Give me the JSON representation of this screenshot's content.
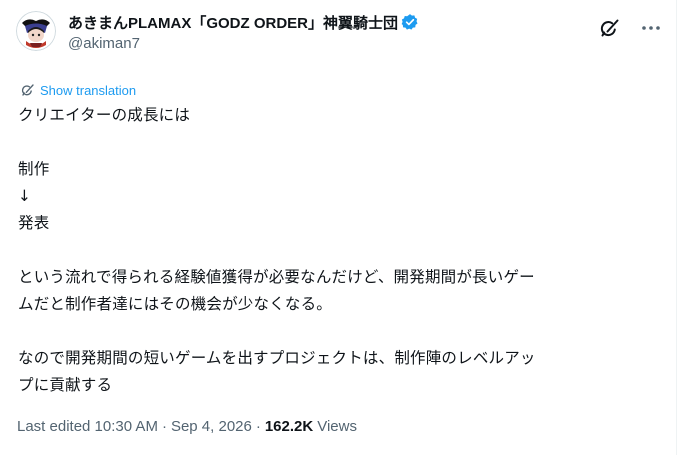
{
  "author": {
    "display_name": "あきまんPLAMAX「GODZ ORDER」神翼騎士団",
    "handle": "@akiman7",
    "avatar_icon": "avatar-illustration",
    "verified_icon": "verified-badge-icon",
    "verified_color": "#1d9bf0"
  },
  "actions": {
    "grok_icon": "grok-icon",
    "more_icon": "more-options-icon"
  },
  "translation": {
    "label": "Show translation",
    "icon": "translate-icon",
    "color": "#1d9bf0"
  },
  "tweet": {
    "lines": [
      "クリエイターの成長には",
      "制作",
      "↓",
      "発表",
      "という流れで得られる経験値獲得が必要なんだけど、開発期間が長いゲー",
      "ムだと制作者達にはその機会が少なくなる。",
      "なので開発期間の短いゲームを出すプロジェクトは、制作陣のレベルアッ",
      "プに貢献する"
    ]
  },
  "footer": {
    "edited": "Last edited 10:30 AM",
    "separator": "·",
    "date": "Sep 4, 2026",
    "views_count": "162.2K",
    "views_label": "Views"
  }
}
